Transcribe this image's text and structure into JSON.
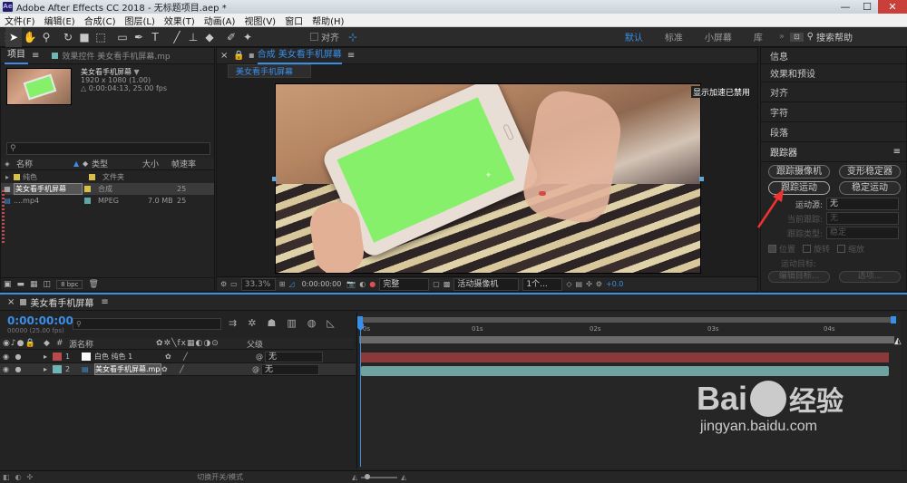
{
  "window": {
    "title": "Adobe After Effects CC 2018 - 无标题项目.aep *",
    "logo": "Ae",
    "min": "—",
    "max": "☐",
    "close": "✕"
  },
  "menu": [
    "文件(F)",
    "编辑(E)",
    "合成(C)",
    "图层(L)",
    "效果(T)",
    "动画(A)",
    "视图(V)",
    "窗口",
    "帮助(H)"
  ],
  "toolbar": {
    "tools": [
      "selection-tool",
      "hand-tool",
      "zoom-tool",
      "rotate-tool",
      "camera-tool",
      "pan-behind-tool",
      "rectangle-tool",
      "pen-tool",
      "type-tool",
      "brush-tool",
      "clone-tool",
      "eraser-tool",
      "roto-tool",
      "puppet-tool"
    ],
    "align_label": "对齐",
    "workspaces": [
      "默认",
      "标准",
      "小屏幕",
      "库"
    ],
    "active_ws": "默认",
    "search_help": "搜索帮助"
  },
  "project": {
    "tab": "项目",
    "effects_tab": "效果控件 美女看手机屏幕.mp",
    "item_name": "美女看手机屏幕",
    "item_dims": "1920 x 1080 (1.00)",
    "item_duration": "△ 0:00:04:13, 25.00 fps",
    "columns": [
      "名称",
      "类型",
      "大小",
      "帧速率"
    ],
    "rows": [
      {
        "name": "纯色",
        "type": "文件夹",
        "size": "",
        "fps": "",
        "color": "#d6c04a"
      },
      {
        "name": "美女看手机屏幕",
        "type": "合成",
        "size": "",
        "fps": "25",
        "color": "#d6c04a"
      },
      {
        "name": "....mp4",
        "type": "MPEG",
        "size": "7.0 MB",
        "fps": "25",
        "color": "#5fa6a6"
      }
    ],
    "bpc": "8 bpc"
  },
  "comp": {
    "tab_title": "合成 美女看手机屏幕",
    "sub_tab": "美女看手机屏幕",
    "overlay": "显示加速已禁用",
    "zoom": "33.3%",
    "timecode": "0:00:00:00",
    "resolution": "完整",
    "camera": "活动摄像机",
    "views": "1个...",
    "exposure": "+0.0"
  },
  "right": {
    "items": [
      "信息",
      "效果和预设",
      "对齐",
      "字符",
      "段落"
    ],
    "tracker_title": "跟踪器",
    "buttons": [
      "跟踪摄像机",
      "变形稳定器",
      "跟踪运动",
      "稳定运动"
    ],
    "motion_source_label": "运动源:",
    "motion_source_value": "无",
    "current_track_label": "当前跟踪:",
    "current_track_value": "无",
    "track_type_label": "跟踪类型:",
    "track_type_value": "稳定",
    "checks": [
      "位置",
      "旋转",
      "缩放"
    ],
    "motion_target": "运动目标:",
    "edit_target": "编辑目标...",
    "options": "选项..."
  },
  "timeline": {
    "tab": "美女看手机屏幕",
    "timecode": "0:00:00:00",
    "fps_sub": "00000 (25.00 fps)",
    "col_name": "源名称",
    "col_parent": "父级",
    "ruler": [
      "0s",
      "01s",
      "02s",
      "03s",
      "04s"
    ],
    "layers": [
      {
        "num": "1",
        "name": "白色 纯色 1",
        "parent": "无",
        "color": "#b84a4a",
        "bar": "#8a3a3a"
      },
      {
        "num": "2",
        "name": "美女看手机屏幕.mp4",
        "parent": "无",
        "color": "#6fb5b5",
        "bar": "#6fa3a0"
      }
    ],
    "toggle": "切换开关/模式"
  },
  "watermark": {
    "brand": "Bai",
    "brand2": "经验",
    "url": "jingyan.baidu.com"
  },
  "colors": {
    "accent": "#3a8ee6",
    "green_screen": "#86f06a"
  }
}
